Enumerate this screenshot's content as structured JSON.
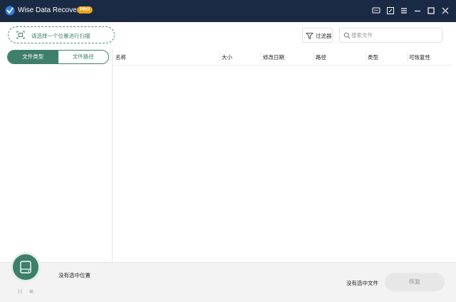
{
  "app": {
    "title": "Wise Data Recovery",
    "badge": "PRO",
    "brand_color": "#1b2a44",
    "accent_color": "#3d7f6a",
    "badge_color": "#e9a21b"
  },
  "titlebar_icons": [
    "feedback-icon",
    "edit-icon",
    "menu-icon",
    "minimize-icon",
    "maximize-icon",
    "close-icon"
  ],
  "toolbar": {
    "scan_label": "请选择一个位置进行扫描",
    "filter_label": "过滤器",
    "search_placeholder": "搜索文件",
    "search_value": ""
  },
  "sidebar": {
    "tabs": [
      {
        "label": "文件类型",
        "active": true
      },
      {
        "label": "文件路径",
        "active": false
      }
    ]
  },
  "table": {
    "columns": [
      "名称",
      "大小",
      "修改日期",
      "路径",
      "类型",
      "可恢复性"
    ],
    "rows": []
  },
  "footer": {
    "location_status": "没有选中位置",
    "file_status": "没有选中文件",
    "recover_label": "恢复"
  }
}
